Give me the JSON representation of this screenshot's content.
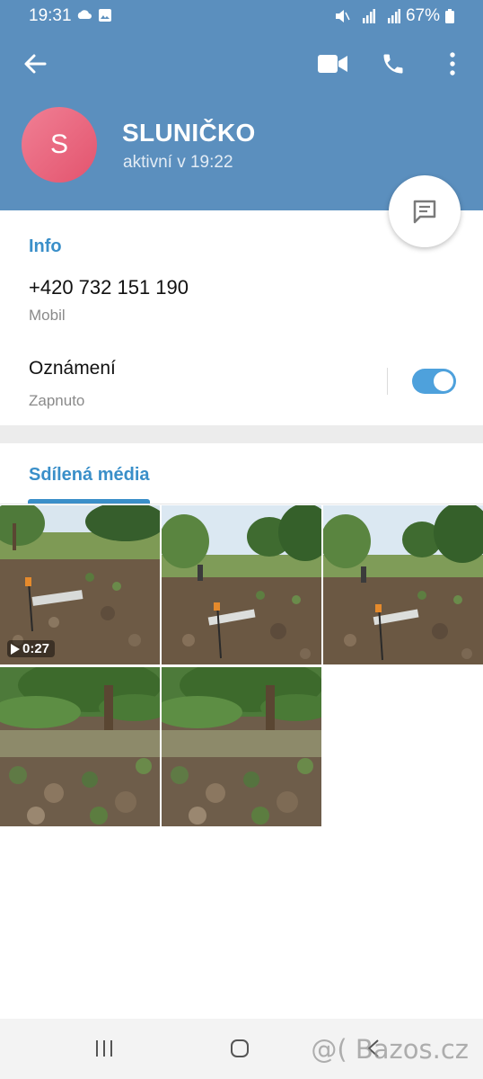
{
  "status": {
    "time": "19:31",
    "battery": "67%"
  },
  "contact": {
    "initial": "S",
    "name": "SLUNIČKO",
    "status": "aktivní v 19:22"
  },
  "info": {
    "title": "Info",
    "phone": "+420 732 151 190",
    "phone_label": "Mobil"
  },
  "notifications": {
    "label": "Oznámení",
    "value": "Zapnuto",
    "enabled": true
  },
  "media": {
    "tab_label": "Sdílená média",
    "video_duration": "0:27"
  },
  "watermark": "@( Bazos.cz",
  "colors": {
    "header": "#5b8fbe",
    "accent": "#3a8fc9",
    "avatar": "#e5637a"
  }
}
